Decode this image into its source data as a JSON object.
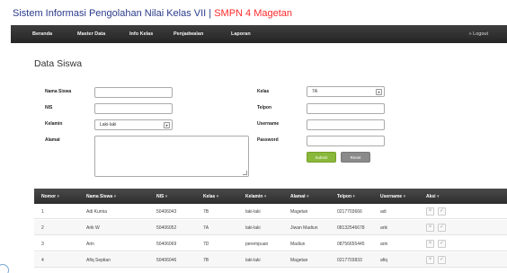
{
  "header": {
    "title": "Sistem Informasi Pengolahan Nilai Kelas VII | ",
    "school": "SMPN 4 Magetan"
  },
  "nav": {
    "items": [
      "Beranda",
      "Master Data",
      "Info Kelas",
      "Penjadwalan",
      "Laporan"
    ],
    "logout": "» Logout"
  },
  "page": {
    "title": "Data Siswa"
  },
  "form": {
    "labels": {
      "nama_siswa": "Nama Siswa",
      "nis": "NIS",
      "kelamin": "Kelamin",
      "alamat": "Alamat",
      "kelas": "Kelas",
      "telpon": "Telpon",
      "username": "Username",
      "password": "Password"
    },
    "values": {
      "nama_siswa": "",
      "nis": "",
      "kelamin": "Laki-laki",
      "alamat": "",
      "kelas": "7A",
      "telpon": "",
      "username": "",
      "password": ""
    },
    "buttons": {
      "submit": "Submit",
      "reset": "Reset"
    }
  },
  "table": {
    "sort_icon": "▾",
    "columns": [
      "Nomor",
      "Nama Siswa",
      "NIS",
      "Kelas",
      "Kelamin",
      "Alamat",
      "Telpon",
      "Username",
      "Aksi"
    ],
    "rows": [
      [
        "1",
        "Adi Kurnia",
        "50406043",
        "7B",
        "laki-laki",
        "Magetan",
        "0217703666",
        "adi"
      ],
      [
        "2",
        "Arik W",
        "50406052",
        "7A",
        "laki-laki",
        "Jiwan Madiun",
        "08132546678",
        "arik"
      ],
      [
        "3",
        "Arin",
        "50406069",
        "7D",
        "perempuan",
        "Madiun",
        "08756655445",
        "arin"
      ],
      [
        "4",
        "Afiq Septian",
        "50406046",
        "7B",
        "laki-laki",
        "Magetan",
        "0217703833",
        "afiq"
      ]
    ],
    "action_icons": {
      "delete": "×",
      "edit": "✓"
    }
  }
}
